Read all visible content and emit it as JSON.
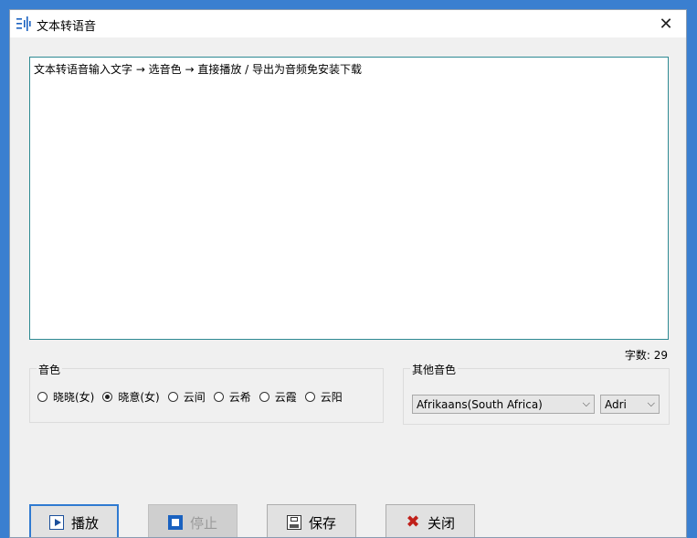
{
  "window": {
    "title": "文本转语音",
    "close_glyph": "✕"
  },
  "editor": {
    "text": "文本转语音输入文字 → 选音色 → 直接播放 / 导出为音频免安装下载"
  },
  "char_count": "字数: 29",
  "voice_group": {
    "legend": "音色",
    "options": [
      {
        "label": "晓晓(女)",
        "checked": false
      },
      {
        "label": "晓意(女)",
        "checked": true
      },
      {
        "label": "云间",
        "checked": false
      },
      {
        "label": "云希",
        "checked": false
      },
      {
        "label": "云霞",
        "checked": false
      },
      {
        "label": "云阳",
        "checked": false
      }
    ]
  },
  "other_group": {
    "legend": "其他音色",
    "language": "Afrikaans(South Africa)",
    "voice": "Adri",
    "chevron": "⌵"
  },
  "buttons": {
    "play": "播放",
    "stop": "停止",
    "save": "保存",
    "close": "关闭",
    "close_icon_glyph": "✖"
  },
  "colors": {
    "accent": "#2f7ad1",
    "editor_border": "#2e8a93"
  }
}
